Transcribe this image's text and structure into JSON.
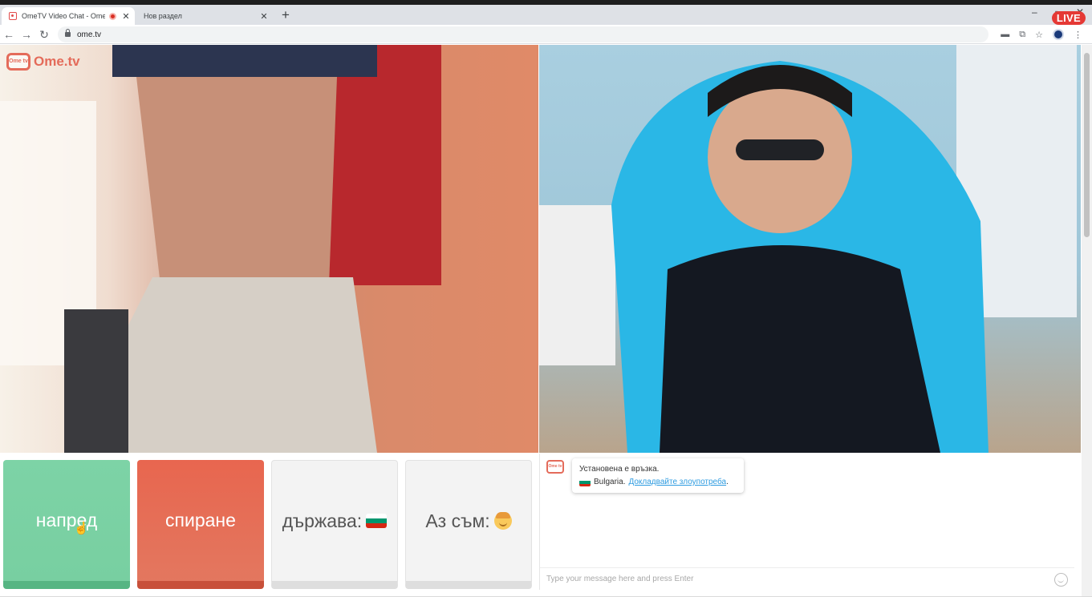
{
  "browser": {
    "tabs": [
      {
        "title": "OmeTV Video Chat - Omegle",
        "recording": true,
        "active": true
      },
      {
        "title": "Нов раздел",
        "recording": false,
        "active": false
      }
    ],
    "new_tab_icon": "plus-icon",
    "live_badge": "LIVE",
    "url": "ome.tv",
    "window_controls": {
      "minimize": "–",
      "maximize": "▫",
      "close": "✕"
    },
    "nav_icons": {
      "back": "←",
      "forward": "→",
      "reload": "↻"
    },
    "toolbar_icons": {
      "camera": "▬",
      "translate": "⧉",
      "bookmark": "☆",
      "menu": "⋮"
    }
  },
  "app": {
    "logo_text": "Ome.tv",
    "logo_badge": "Ome tv",
    "buttons": {
      "next": "напред",
      "stop": "спиране",
      "country": "държава:",
      "gender": "Аз съм:"
    },
    "country_flag_colors": [
      "#ffffff",
      "#00966e",
      "#d62612"
    ]
  },
  "chat": {
    "system_message": "Установена е връзка.",
    "country_name": "Bulgaria.",
    "report_link": "Докладвайте злоупотреба",
    "report_suffix": ".",
    "input_placeholder": "Type your message here and press Enter"
  }
}
